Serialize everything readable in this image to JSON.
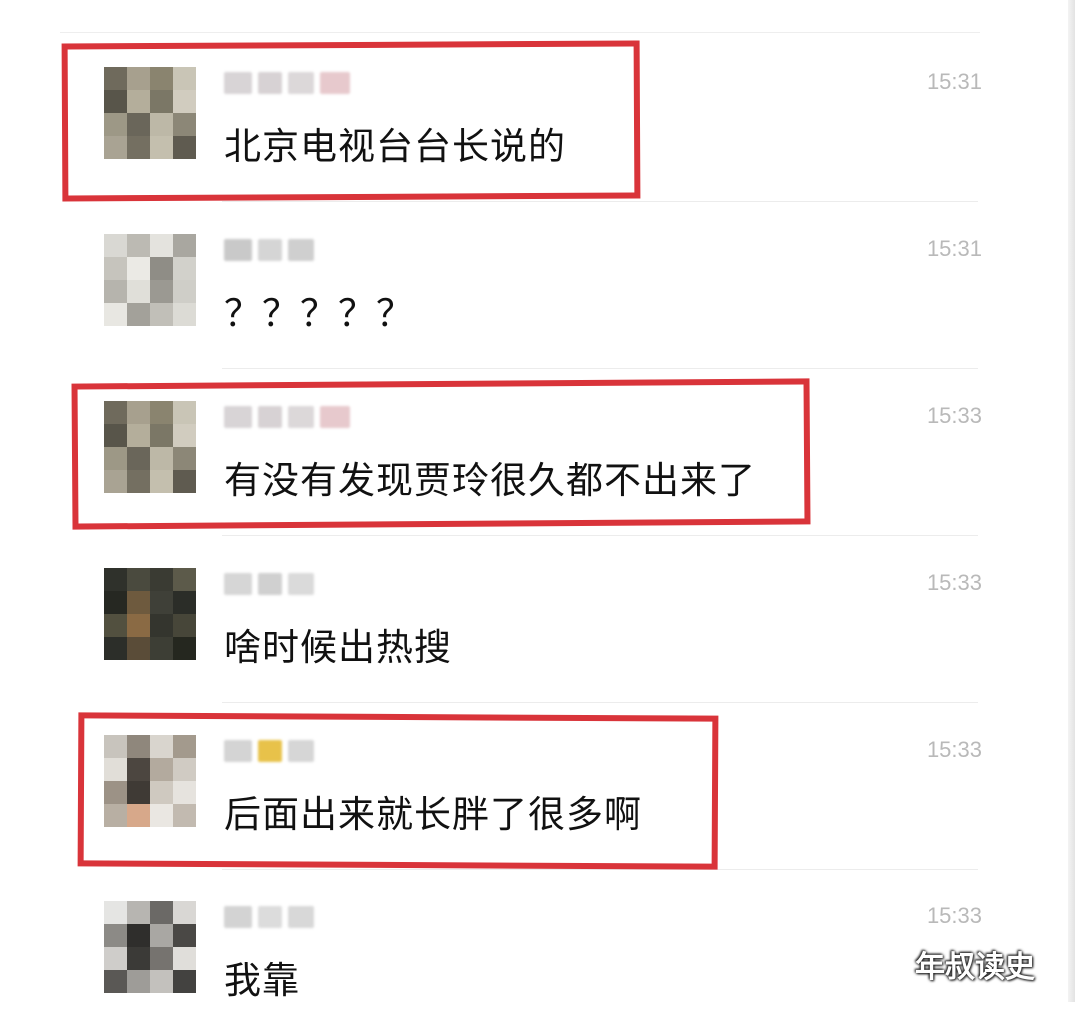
{
  "chat": {
    "messages": [
      {
        "text": "北京电视台台长说的",
        "time": "15:31",
        "highlighted": true,
        "avatar_colors": [
          "#6f6a5c",
          "#a7a08e",
          "#8a846f",
          "#c9c5b6",
          "#58554a",
          "#b4ae9b",
          "#7b7766",
          "#d1ccbf",
          "#9d9886",
          "#6a665a",
          "#bdb8a7",
          "#8c8777",
          "#a9a393",
          "#746f61",
          "#c4bfae",
          "#5f5b50"
        ],
        "name_colors": [
          "#d8d4d6",
          "#d7d2d4",
          "#dcd8d9",
          "#e7c9cd"
        ]
      },
      {
        "text": "？？？？？",
        "time": "15:31",
        "highlighted": false,
        "avatar_colors": [
          "#d9d8d3",
          "#bcbab3",
          "#e4e3de",
          "#a9a7a0",
          "#c6c4bd",
          "#ebeae5",
          "#8f8d86",
          "#d2d1cb",
          "#b6b4ad",
          "#e0dfd9",
          "#9b9992",
          "#cfcec8",
          "#e8e7e2",
          "#a3a19a",
          "#c1bfb8",
          "#dcdbd5"
        ],
        "name_colors": [
          "#c9c9c9",
          "#d5d5d5",
          "#cfcfcf"
        ]
      },
      {
        "text": "有没有发现贾玲很久都不出来了",
        "time": "15:33",
        "highlighted": true,
        "avatar_colors": [
          "#6f6a5c",
          "#a7a08e",
          "#8a846f",
          "#c9c5b6",
          "#58554a",
          "#b4ae9b",
          "#7b7766",
          "#d1ccbf",
          "#9d9886",
          "#6a665a",
          "#bdb8a7",
          "#8c8777",
          "#a9a393",
          "#746f61",
          "#c4bfae",
          "#5f5b50"
        ],
        "name_colors": [
          "#d8d4d6",
          "#d7d2d4",
          "#dcd8d9",
          "#e7c9cd"
        ]
      },
      {
        "text": "啥时候出热搜",
        "time": "15:33",
        "highlighted": false,
        "avatar_colors": [
          "#2f312b",
          "#4a4a3e",
          "#3a3b33",
          "#5c5a4a",
          "#262822",
          "#6e5a3e",
          "#3f4038",
          "#2b2d28",
          "#52503f",
          "#8a6a44",
          "#34352e",
          "#474639",
          "#2c2e29",
          "#5a4c38",
          "#3d3e35",
          "#25271f"
        ],
        "name_colors": [
          "#d6d6d6",
          "#d0d0d0",
          "#dadada"
        ]
      },
      {
        "text": "后面出来就长胖了很多啊",
        "time": "15:33",
        "highlighted": true,
        "avatar_colors": [
          "#c8c4bd",
          "#8f877c",
          "#d9d5ce",
          "#a39a8d",
          "#e1ded8",
          "#4c4640",
          "#b3aa9e",
          "#d0cbc3",
          "#9c9286",
          "#3f3a35",
          "#cfc9c0",
          "#e6e3de",
          "#b8afa3",
          "#d7a88a",
          "#eae7e2",
          "#c2bab0"
        ],
        "name_colors": [
          "#d4d4d4",
          "#e8c24a",
          "#d6d6d6"
        ]
      },
      {
        "text": "我靠",
        "time": "15:33",
        "highlighted": false,
        "avatar_colors": [
          "#e5e5e3",
          "#b7b5b1",
          "#6b6966",
          "#d9d7d4",
          "#8c8a86",
          "#2f2e2c",
          "#a9a7a3",
          "#4a4845",
          "#cfcdca",
          "#3b3a37",
          "#76736f",
          "#e0deda",
          "#5a5855",
          "#9e9c98",
          "#c3c1bd",
          "#434240"
        ],
        "name_colors": [
          "#d3d3d3",
          "#dcdcdc",
          "#d8d8d8"
        ]
      }
    ]
  },
  "watermark": {
    "text": "年叔读史"
  }
}
